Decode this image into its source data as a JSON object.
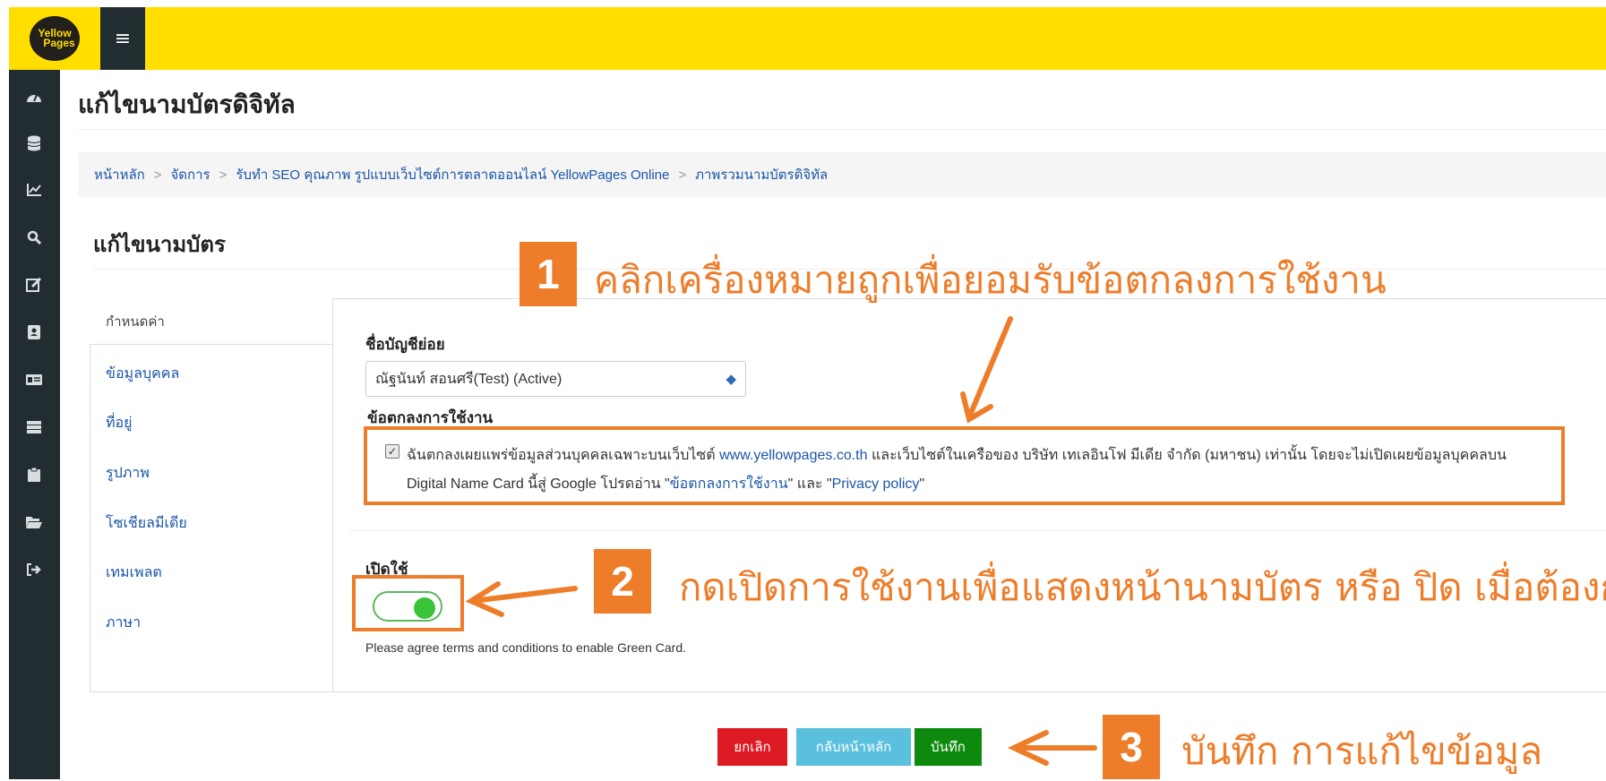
{
  "header": {
    "logo_line1": "Yellow",
    "logo_line2": "Pages",
    "menu_icon": "hamburger-icon"
  },
  "sidebar": {
    "icons": [
      "dashboard-icon",
      "database-icon",
      "chart-icon",
      "search-icon",
      "edit-icon",
      "contact-card-icon",
      "id-card-icon",
      "server-icon",
      "clipboard-icon",
      "folder-open-icon",
      "sign-out-icon"
    ]
  },
  "page": {
    "title": "แก้ไขนามบัตรดิจิทัล"
  },
  "breadcrumb": [
    "หน้าหลัก",
    "จัดการ",
    "รับทำ SEO คุณภาพ รูปแบบเว็บไซต์การตลาดออนไลน์ YellowPages Online",
    "ภาพรวมนามบัตรดิจิทัล"
  ],
  "breadcrumb_sep": ">",
  "section": {
    "title": "แก้ไขนามบัตร"
  },
  "tabs": [
    "กำหนดค่า",
    "ข้อมูลบุคคล",
    "ที่อยู่",
    "รูปภาพ",
    "โซเชียลมีเดีย",
    "เทมเพลต",
    "ภาษา"
  ],
  "form": {
    "account_label": "ชื่อบัญชีย่อย",
    "account_value": "ณัฐนันท์ สอนศรี(Test) (Active)",
    "terms_label": "ข้อตกลงการใช้งาน",
    "terms_checked": true,
    "terms_line1_a": "ฉันตกลงเผยแพร่ข้อมูลส่วนบุคคลเฉพาะบนเว็บไซต์ ",
    "terms_link_site": "www.yellowpages.co.th",
    "terms_line1_b": " และเว็บไซต์ในเครือของ บริษัท เทเลอินโฟ มีเดีย จำกัด (มหาชน) เท่านั้น โดยจะไม่เปิดเผยข้อมูลบุคคลบน",
    "terms_line2_a": "Digital Name Card นี้สู่ Google โปรดอ่าน \"",
    "terms_link_terms": "ข้อตกลงการใช้งาน",
    "terms_line2_b": "\" และ \"",
    "terms_link_privacy": "Privacy policy",
    "terms_line2_c": "\"",
    "enable_label": "เปิดใช้",
    "enabled": true,
    "help_text": "Please agree terms and conditions to enable Green Card."
  },
  "buttons": {
    "cancel": "ยกเลิก",
    "back": "กลับหน้าหลัก",
    "save": "บันทึก"
  },
  "annotations": [
    {
      "num": "1",
      "text": "คลิกเครื่องหมายถูกเพื่อยอมรับข้อตกลงการใช้งาน"
    },
    {
      "num": "2",
      "text": "กดเปิดการใช้งานเพื่อแสดงหน้านามบัตร หรือ ปิด เมื่อต้องกา"
    },
    {
      "num": "3",
      "text": "บันทึก การแก้ไขข้อมูล"
    }
  ],
  "colors": {
    "topbar": "#ffde00",
    "sidebar": "#222d32",
    "annotation": "#ee7d2a",
    "link": "#1a56a6",
    "cancel": "#dd1b24",
    "back": "#5bc0de",
    "save": "#0d8a0d"
  }
}
